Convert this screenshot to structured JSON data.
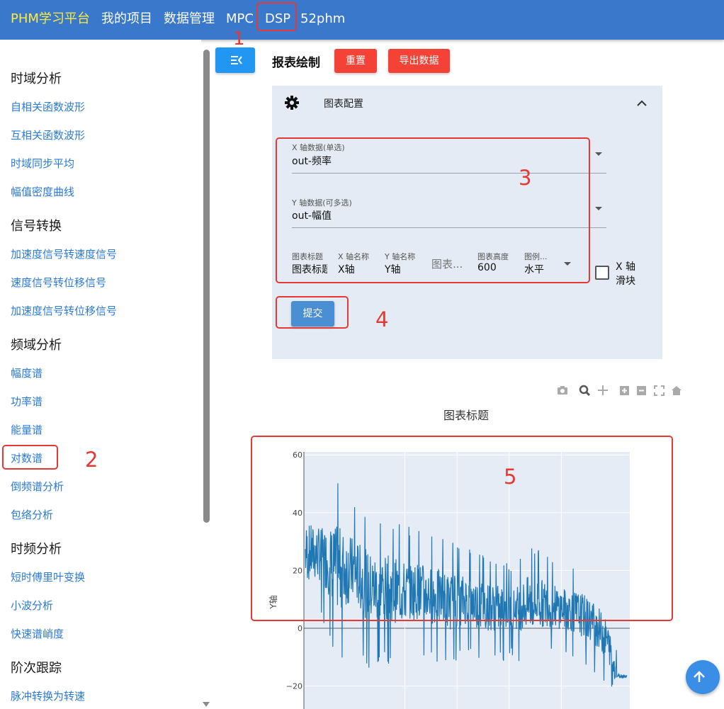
{
  "topbar": {
    "brand": "PHM学习平台",
    "items": [
      "我的项目",
      "数据管理",
      "MPC",
      "DSP",
      "52phm"
    ]
  },
  "sidebar": {
    "sections": [
      {
        "title": "时域分析",
        "items": [
          "自相关函数波形",
          "互相关函数波形",
          "时域同步平均",
          "幅值密度曲线"
        ]
      },
      {
        "title": "信号转换",
        "items": [
          "加速度信号转速度信号",
          "速度信号转位移信号",
          "加速度信号转位移信号"
        ]
      },
      {
        "title": "频域分析",
        "items": [
          "幅度谱",
          "功率谱",
          "能量谱",
          "对数谱",
          "倒频谱分析",
          "包络分析"
        ]
      },
      {
        "title": "时频分析",
        "items": [
          "短时傅里叶变换",
          "小波分析",
          "快速谱峭度"
        ]
      },
      {
        "title": "阶次跟踪",
        "items": [
          "脉冲转换为转速"
        ]
      }
    ]
  },
  "toolbar": {
    "title": "报表绘制",
    "reset_label": "重置",
    "export_label": "导出数据"
  },
  "config": {
    "title": "图表配置",
    "x_field": {
      "label": "X 轴数据(单选)",
      "value": "out-频率"
    },
    "y_field": {
      "label": "Y 轴数据(可多选)",
      "value": "out-幅值"
    },
    "chart_title": {
      "label": "图表标题",
      "value": "图表标题"
    },
    "x_name": {
      "label": "X 轴名称",
      "value": "X轴"
    },
    "y_name": {
      "label": "Y 轴名称",
      "value": "Y轴"
    },
    "width_placeholder": "图表...",
    "height": {
      "label": "图表高度",
      "value": "600"
    },
    "legend": {
      "label": "图例...",
      "value": "水平"
    },
    "slider_label_1": "X 轴",
    "slider_label_2": "滑块",
    "submit_label": "提交"
  },
  "annotations": [
    "1",
    "2",
    "3",
    "4",
    "5"
  ],
  "chart_data": {
    "type": "line",
    "title": "图表标题",
    "ylabel": "Y轴",
    "xlabel": "",
    "yticks": [
      "60",
      "40",
      "20",
      "0",
      "−20"
    ],
    "ylim": [
      -28,
      62
    ],
    "x_range": [
      0,
      1
    ],
    "series": [
      {
        "color": "#1f77b4",
        "envelope_y": [
          [
            0.0,
            2,
            48
          ],
          [
            0.05,
            4,
            45
          ],
          [
            0.1,
            -14,
            52
          ],
          [
            0.15,
            -6,
            44
          ],
          [
            0.2,
            -15,
            40
          ],
          [
            0.25,
            -12,
            38
          ],
          [
            0.3,
            -14,
            36
          ],
          [
            0.35,
            -10,
            34
          ],
          [
            0.4,
            -12,
            32
          ],
          [
            0.45,
            -14,
            30
          ],
          [
            0.5,
            -10,
            28
          ],
          [
            0.55,
            -12,
            26
          ],
          [
            0.6,
            -12,
            24
          ],
          [
            0.65,
            -10,
            22
          ],
          [
            0.7,
            -15,
            30
          ],
          [
            0.75,
            -10,
            25
          ],
          [
            0.8,
            -10,
            22
          ],
          [
            0.85,
            -12,
            21
          ],
          [
            0.9,
            -16,
            18
          ],
          [
            0.94,
            -20,
            10
          ],
          [
            0.97,
            -25,
            -8
          ],
          [
            1.0,
            -17,
            -16
          ]
        ]
      }
    ],
    "grid": true
  }
}
